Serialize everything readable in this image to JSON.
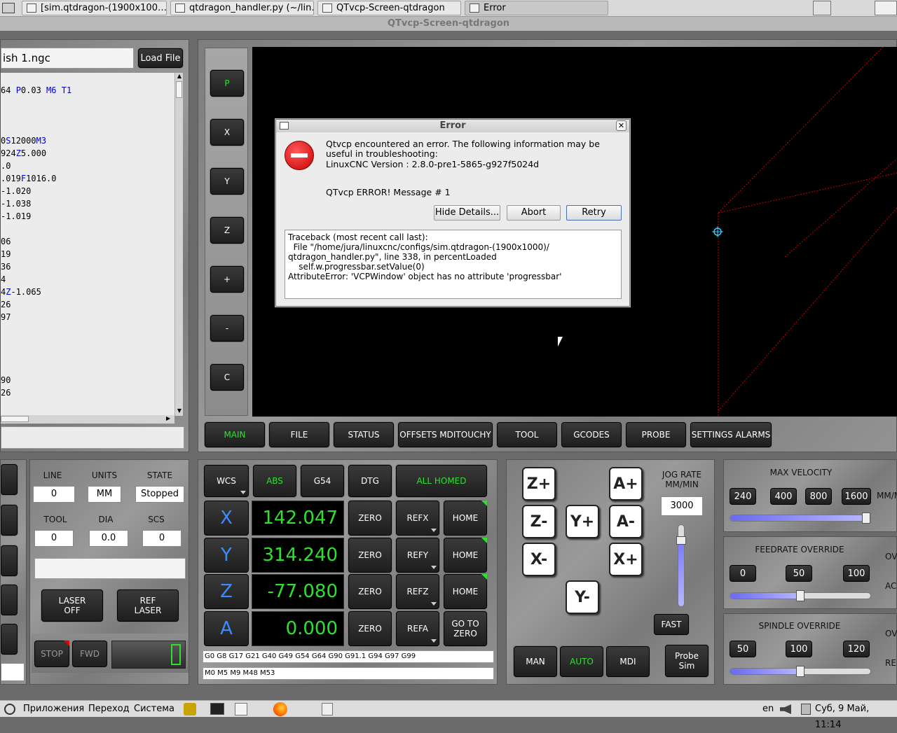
{
  "taskbar": {
    "tabs": [
      {
        "label": "[sim.qtdragon-(1900x100…"
      },
      {
        "label": "qtdragon_handler.py (~/lin…"
      },
      {
        "label": "QTvcp-Screen-qtdragon"
      },
      {
        "label": "Error"
      }
    ]
  },
  "window_title": "QTvcp-Screen-qtdragon",
  "file": {
    "name": "ish 1.ngc",
    "load_label": "Load File"
  },
  "gcode_lines": [
    {
      "parts": [
        {
          "t": "64 ",
          "c": "#000"
        },
        {
          "t": "P",
          "c": "#0000c8"
        },
        {
          "t": "0.03 ",
          "c": "#000"
        },
        {
          "t": "M6",
          "c": "#0000c8"
        },
        {
          "t": " ",
          "c": "#000"
        },
        {
          "t": "T1",
          "c": "#0000c8"
        }
      ]
    },
    {
      "parts": []
    },
    {
      "parts": []
    },
    {
      "parts": []
    },
    {
      "parts": [
        {
          "t": "0",
          "c": "#000"
        },
        {
          "t": "S",
          "c": "#0000c8"
        },
        {
          "t": "12000",
          "c": "#000"
        },
        {
          "t": "M3",
          "c": "#0000c8"
        }
      ]
    },
    {
      "parts": [
        {
          "t": "924",
          "c": "#000"
        },
        {
          "t": "Z",
          "c": "#0000c8"
        },
        {
          "t": "5.000",
          "c": "#000"
        }
      ]
    },
    {
      "parts": [
        {
          "t": ".0",
          "c": "#000"
        }
      ]
    },
    {
      "parts": [
        {
          "t": ".019",
          "c": "#000"
        },
        {
          "t": "F",
          "c": "#0000c8"
        },
        {
          "t": "1016.0",
          "c": "#000"
        }
      ]
    },
    {
      "parts": [
        {
          "t": "-1.020",
          "c": "#000"
        }
      ]
    },
    {
      "parts": [
        {
          "t": "-1.038",
          "c": "#000"
        }
      ]
    },
    {
      "parts": [
        {
          "t": "-1.019",
          "c": "#000"
        }
      ]
    },
    {
      "parts": []
    },
    {
      "parts": [
        {
          "t": "06",
          "c": "#000"
        }
      ]
    },
    {
      "parts": [
        {
          "t": "19",
          "c": "#000"
        }
      ]
    },
    {
      "parts": [
        {
          "t": "36",
          "c": "#000"
        }
      ]
    },
    {
      "parts": [
        {
          "t": "4",
          "c": "#000"
        }
      ]
    },
    {
      "parts": [
        {
          "t": "4",
          "c": "#000"
        },
        {
          "t": "Z",
          "c": "#0000c8"
        },
        {
          "t": "-1.065",
          "c": "#000"
        }
      ]
    },
    {
      "parts": [
        {
          "t": "26",
          "c": "#000"
        }
      ]
    },
    {
      "parts": [
        {
          "t": "97",
          "c": "#000"
        }
      ]
    },
    {
      "parts": []
    },
    {
      "parts": []
    },
    {
      "parts": []
    },
    {
      "parts": []
    },
    {
      "parts": [
        {
          "t": "90",
          "c": "#000"
        }
      ]
    },
    {
      "parts": [
        {
          "t": "26",
          "c": "#000"
        }
      ]
    }
  ],
  "side_buttons": [
    "P",
    "X",
    "Y",
    "Z",
    "+",
    "-",
    "C"
  ],
  "tabs": [
    "MAIN",
    "FILE",
    "STATUS",
    "OFFSETS MDITOUCHY",
    "TOOL",
    "GCODES",
    "PROBE",
    "SETTINGS ALARMS"
  ],
  "dialog": {
    "title": "Error",
    "message": "Qtvcp encountered an error.  The following information may be useful in troubleshooting:",
    "version": "LinuxCNC Version  : 2.8.0-pre1-5865-g927f5024d",
    "error_line": "QTvcp ERROR! Message # 1",
    "hide_details": "Hide Details...",
    "abort": "Abort",
    "retry": "Retry",
    "traceback": [
      "Traceback (most recent call last):",
      "  File \"/home/jura/linuxcnc/configs/sim.qtdragon-(1900x1000)/",
      "qtdragon_handler.py\", line 338, in percentLoaded",
      "    self.w.progressbar.setValue(0)",
      "AttributeError: 'VCPWindow' object has no attribute 'progressbar'"
    ]
  },
  "status": {
    "line_label": "LINE",
    "line_value": "0",
    "units_label": "UNITS",
    "units_value": "MM",
    "state_label": "STATE",
    "state_value": "Stopped",
    "tool_label": "TOOL",
    "tool_value": "0",
    "dia_label": "DIA",
    "dia_value": "0.0",
    "scs_label": "SCS",
    "scs_value": "0",
    "laser_off": "LASER\nOFF",
    "ref_laser": "REF\nLASER",
    "stop": "STOP",
    "fwd": "FWD"
  },
  "dro": {
    "wcs": "WCS",
    "abs": "ABS",
    "g54": "G54",
    "dtg": "DTG",
    "all_homed": "ALL HOMED",
    "axes": [
      {
        "name": "X",
        "value": "142.047",
        "zero": "ZERO",
        "ref": "REFX",
        "home": "HOME"
      },
      {
        "name": "Y",
        "value": "314.240",
        "zero": "ZERO",
        "ref": "REFY",
        "home": "HOME"
      },
      {
        "name": "Z",
        "value": "-77.080",
        "zero": "ZERO",
        "ref": "REFZ",
        "home": "HOME"
      },
      {
        "name": "A",
        "value": "0.000",
        "zero": "ZERO",
        "ref": "REFA",
        "home": "GO TO\nZERO"
      }
    ],
    "gcodes": "G0 G8 G17 G21 G40 G49 G54 G64 G90 G91.1 G94 G97 G99",
    "mcodes": "M0 M5 M9 M48 M53"
  },
  "jog": {
    "buttons": [
      "Z+",
      "A+",
      "Z-",
      "Y+",
      "A-",
      "X-",
      "X+",
      "Y-"
    ],
    "rate_label": "JOG RATE\nMM/MIN",
    "rate_value": "3000",
    "fast": "FAST",
    "man": "MAN",
    "auto": "AUTO",
    "mdi": "MDI",
    "probe_sim": "Probe\nSim"
  },
  "overrides": {
    "max_velocity_label": "MAX VELOCITY",
    "max_velocity_presets": [
      "240",
      "400",
      "800",
      "1600"
    ],
    "max_velocity_unit": "MM/M",
    "max_velocity_level": 0.97,
    "feed_label": "FEEDRATE OVERRIDE",
    "feed_presets": [
      "0",
      "50",
      "100"
    ],
    "feed_level": 0.5,
    "feed_side1": "OV",
    "feed_side2": "AC",
    "spindle_label": "SPINDLE OVERRIDE",
    "spindle_presets": [
      "50",
      "100",
      "120"
    ],
    "spindle_level": 0.5,
    "spindle_side1": "OV",
    "spindle_side2": "RE"
  },
  "bottombar": {
    "apps": "Приложения",
    "go": "Переход",
    "system": "Система",
    "lang": "en",
    "clock": "Суб,  9 Май, 11:14"
  }
}
